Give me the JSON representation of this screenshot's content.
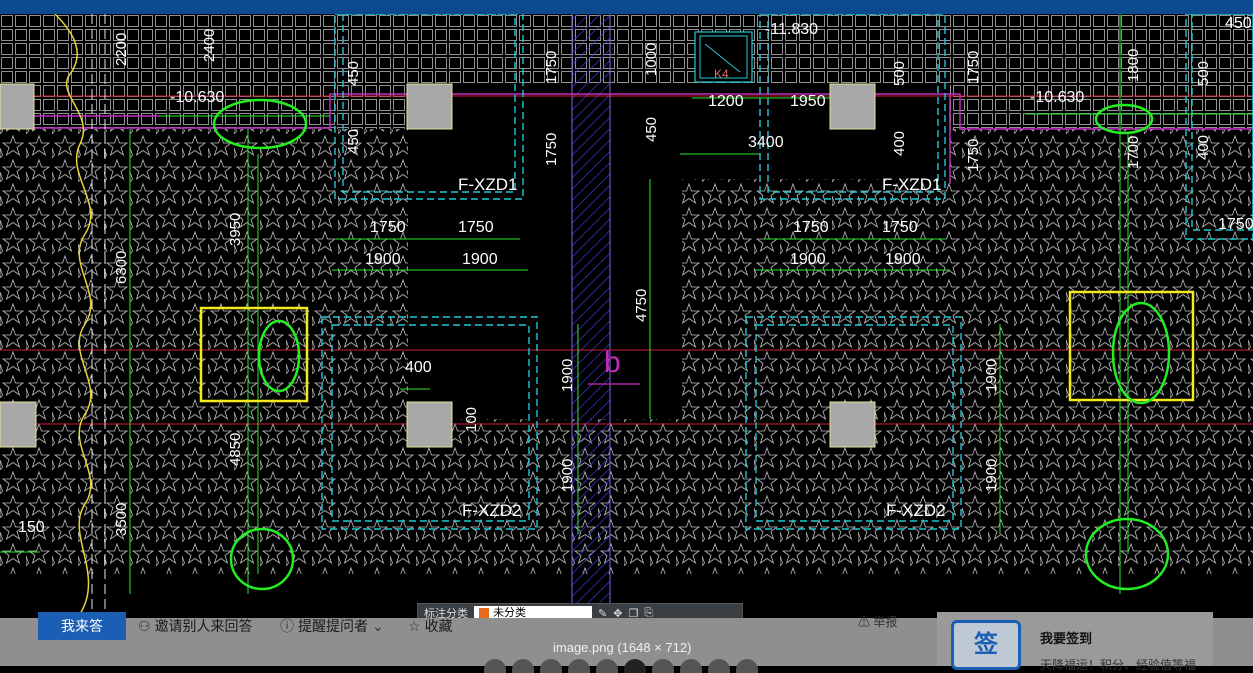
{
  "drawing": {
    "elevations": [
      "-10.630",
      "-11.830",
      "-10.630"
    ],
    "foundations": [
      "F-XZD1",
      "F-XZD1",
      "F-XZD2",
      "F-XZD2"
    ],
    "window_tag": "K4",
    "axis_label": "b",
    "dims": {
      "d2200": "2200",
      "d2400": "2400",
      "d450": "450",
      "d1750": "1750",
      "d1000": "1000",
      "d1200": "1200",
      "d1950": "1950",
      "d500": "500",
      "d1800": "1800",
      "d3400": "3400",
      "d400": "400",
      "d1700": "1700",
      "d3950": "3950",
      "d6300": "6300",
      "d1900": "1900",
      "d4750": "4750",
      "d4850": "4850",
      "d3500": "3500",
      "d150": "150",
      "d100": "100"
    }
  },
  "toolbar": {
    "label": "标注分类",
    "value": "未分类",
    "tools": [
      "pen-icon",
      "move-icon",
      "copy-icon",
      "paste-icon"
    ]
  },
  "qa": {
    "answer_button": "我来答",
    "invite": "邀请别人来回答",
    "remind": "提醒提问者",
    "collect": "收藏",
    "report": "举报"
  },
  "viewer": {
    "caption": "image.png (1648 × 712)",
    "thumb_count": 10
  },
  "signin": {
    "icon_char": "签",
    "title": "我要签到",
    "subtitle": "天降福运！积分、经验值等福"
  },
  "colors": {
    "cad_bg": "#000000",
    "hatch": "#bfbfbf",
    "dim": "#2ee62e",
    "dashed_outline": "#22c7d6",
    "axis_red": "#cc2233",
    "beam_magenta": "#c02cc0",
    "column_fill": "#a8a8a8",
    "highlight_green": "#22ee22",
    "highlight_yellow": "#f5ea1a",
    "brand_blue": "#1a5fb4"
  }
}
